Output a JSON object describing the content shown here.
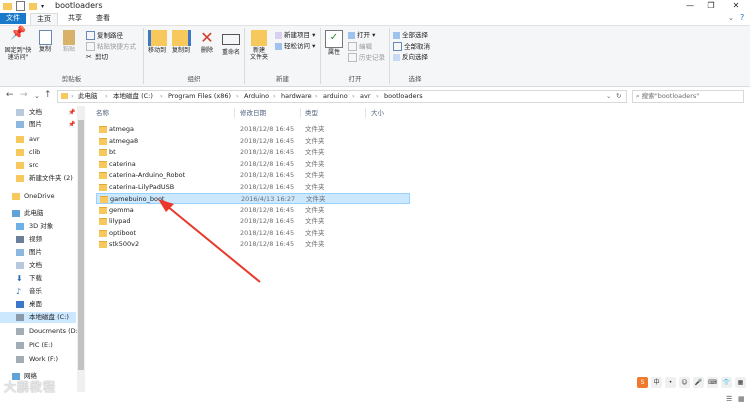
{
  "window": {
    "title": "bootloaders",
    "controls": [
      "—",
      "❐",
      "✕"
    ]
  },
  "ribbon_tabs": [
    "文件",
    "主页",
    "共享",
    "查看"
  ],
  "ribbon": {
    "clipboard": {
      "label": "剪贴板",
      "pin": "固定到\"快\n速访问\"",
      "copy": "复制",
      "paste": "粘贴",
      "copy_path": "复制路径",
      "paste_shortcut": "粘贴快捷方式",
      "cut": "剪切"
    },
    "organize": {
      "label": "组织",
      "move_to": "移动到",
      "copy_to": "复制到",
      "delete": "删除",
      "rename": "重命名"
    },
    "new": {
      "label": "新建",
      "new_folder": "新建\n文件夹",
      "new_item": "新建项目",
      "easy_access": "轻松访问"
    },
    "open": {
      "label": "打开",
      "properties": "属性",
      "open": "打开",
      "edit": "编辑",
      "history": "历史记录"
    },
    "select": {
      "label": "选择",
      "select_all": "全部选择",
      "select_none": "全部取消",
      "invert": "反向选择"
    }
  },
  "address": {
    "path": [
      "此电脑",
      "本地磁盘 (C:)",
      "Program Files (x86)",
      "Arduino",
      "hardware",
      "arduino",
      "avr",
      "bootloaders"
    ],
    "search_placeholder": "搜索\"bootloaders\""
  },
  "nav": {
    "items": [
      {
        "label": "文档",
        "icon": "docs-icon"
      },
      {
        "label": "图片",
        "icon": "pictures-icon"
      },
      {
        "label": "avr",
        "icon": "folder-icon"
      },
      {
        "label": "clib",
        "icon": "folder-icon"
      },
      {
        "label": "src",
        "icon": "folder-icon"
      },
      {
        "label": "新建文件夹 (2)",
        "icon": "folder-icon"
      },
      {
        "label": "OneDrive",
        "icon": "cloud-icon"
      },
      {
        "label": "此电脑",
        "icon": "pc-icon"
      },
      {
        "label": "3D 对象",
        "icon": "cube-icon"
      },
      {
        "label": "视频",
        "icon": "video-icon"
      },
      {
        "label": "图片",
        "icon": "pictures-icon"
      },
      {
        "label": "文档",
        "icon": "docs-icon"
      },
      {
        "label": "下载",
        "icon": "download-icon"
      },
      {
        "label": "音乐",
        "icon": "music-icon"
      },
      {
        "label": "桌面",
        "icon": "desktop-icon"
      },
      {
        "label": "本地磁盘 (C:)",
        "icon": "drive-icon"
      },
      {
        "label": "Doucments (D:",
        "icon": "drive-icon"
      },
      {
        "label": "PIC (E:)",
        "icon": "drive-icon"
      },
      {
        "label": "Work (F:)",
        "icon": "drive-icon"
      },
      {
        "label": "网络",
        "icon": "network-icon"
      }
    ]
  },
  "columns": [
    "名称",
    "修改日期",
    "类型",
    "大小"
  ],
  "files": [
    {
      "name": "atmega",
      "date": "2018/12/8 16:45",
      "type": "文件夹"
    },
    {
      "name": "atmega8",
      "date": "2018/12/8 16:45",
      "type": "文件夹"
    },
    {
      "name": "bt",
      "date": "2018/12/8 16:45",
      "type": "文件夹"
    },
    {
      "name": "caterina",
      "date": "2018/12/8 16:45",
      "type": "文件夹"
    },
    {
      "name": "caterina-Arduino_Robot",
      "date": "2018/12/8 16:45",
      "type": "文件夹"
    },
    {
      "name": "caterina-LilyPadUSB",
      "date": "2018/12/8 16:45",
      "type": "文件夹"
    },
    {
      "name": "gamebuino_boot",
      "date": "2016/4/13 16:27",
      "type": "文件夹"
    },
    {
      "name": "gemma",
      "date": "2018/12/8 16:45",
      "type": "文件夹"
    },
    {
      "name": "lilypad",
      "date": "2018/12/8 16:45",
      "type": "文件夹"
    },
    {
      "name": "optiboot",
      "date": "2018/12/8 16:45",
      "type": "文件夹"
    },
    {
      "name": "stk500v2",
      "date": "2018/12/8 16:45",
      "type": "文件夹"
    }
  ],
  "selected_index": 6,
  "watermark": "大鹏教程",
  "colors": {
    "accent": "#1979ca",
    "selection": "#cce8ff",
    "folder": "#f7c85c",
    "arrow": "#e8392b"
  }
}
